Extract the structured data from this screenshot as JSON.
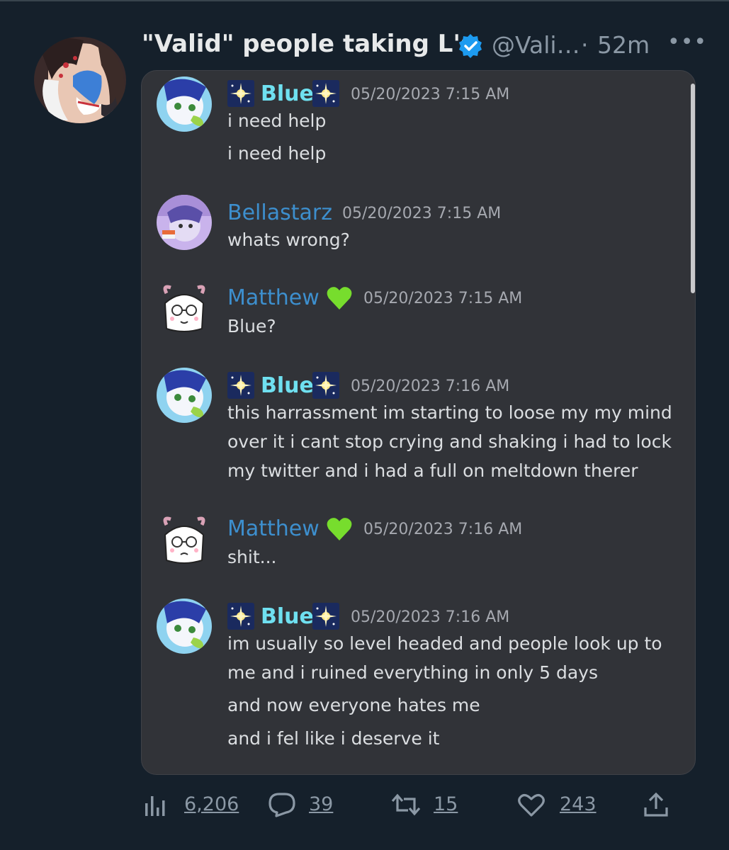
{
  "tweet": {
    "display_name": "\"Valid\" people taking L's",
    "handle": "@Vali…",
    "separator": "·",
    "time": "52m",
    "more": "•••"
  },
  "messages": [
    {
      "user": "Blue",
      "timestamp": "05/20/2023 7:15 AM",
      "lines": [
        "i need help",
        "i need help"
      ]
    },
    {
      "user": "Bellastarz",
      "timestamp": "05/20/2023 7:15 AM",
      "lines": [
        "whats wrong?"
      ]
    },
    {
      "user": "Matthew",
      "timestamp": "05/20/2023 7:15 AM",
      "lines": [
        "Blue?"
      ]
    },
    {
      "user": "Blue",
      "timestamp": "05/20/2023 7:16 AM",
      "lines": [
        "this harrassment im starting to loose my my mind",
        "over it i cant stop crying and shaking i had to lock",
        "my twitter and i had a full on meltdown therer"
      ]
    },
    {
      "user": "Matthew",
      "timestamp": "05/20/2023 7:16 AM",
      "lines": [
        "shit..."
      ]
    },
    {
      "user": "Blue",
      "timestamp": "05/20/2023 7:16 AM",
      "lines": [
        "im usually so level headed and people look up to",
        "me and i ruined everything in only 5 days",
        "and now everyone hates me",
        "and i fel like i deserve it"
      ]
    }
  ],
  "stats": {
    "views": "6,206",
    "replies": "39",
    "reposts": "15",
    "likes": "243"
  },
  "colors": {
    "background": "#15202b",
    "discord_bg": "#313338",
    "blue_name": "#6fe0f0",
    "link_name": "#3d8fce",
    "verified": "#1d9bf0",
    "heart_emoji": "#77dd2d"
  },
  "icons": {
    "verified": "verified-badge-icon",
    "views": "bar-chart-icon",
    "reply": "speech-bubble-icon",
    "repost": "repost-arrows-icon",
    "like": "heart-outline-icon",
    "share": "share-upload-icon",
    "sparkle": "sparkle-emoji",
    "green_heart": "green-heart-emoji"
  }
}
